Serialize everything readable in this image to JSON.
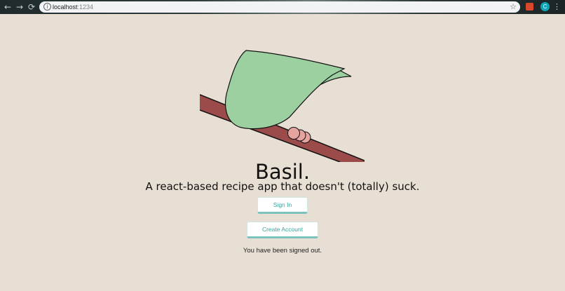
{
  "browser": {
    "nav": {
      "back": "←",
      "forward": "→",
      "reload": "⟳"
    },
    "url_host": "localhost",
    "url_port": ":1234",
    "info_icon": "i",
    "star_icon": "☆",
    "avatar_letter": "C",
    "menu_icon": "⋮"
  },
  "app": {
    "title": "Basil.",
    "tagline": "A react-based recipe app that doesn't (totally) suck.",
    "signin_label": "Sign In",
    "create_account_label": "Create Account",
    "status": "You have been signed out."
  },
  "colors": {
    "background": "#e8dfd4",
    "leaf": "#9dd0a0",
    "branch": "#9a4b4a",
    "bud": "#e6a4a1",
    "button_text": "#3aa49c",
    "button_border": "#7cc3bd"
  }
}
